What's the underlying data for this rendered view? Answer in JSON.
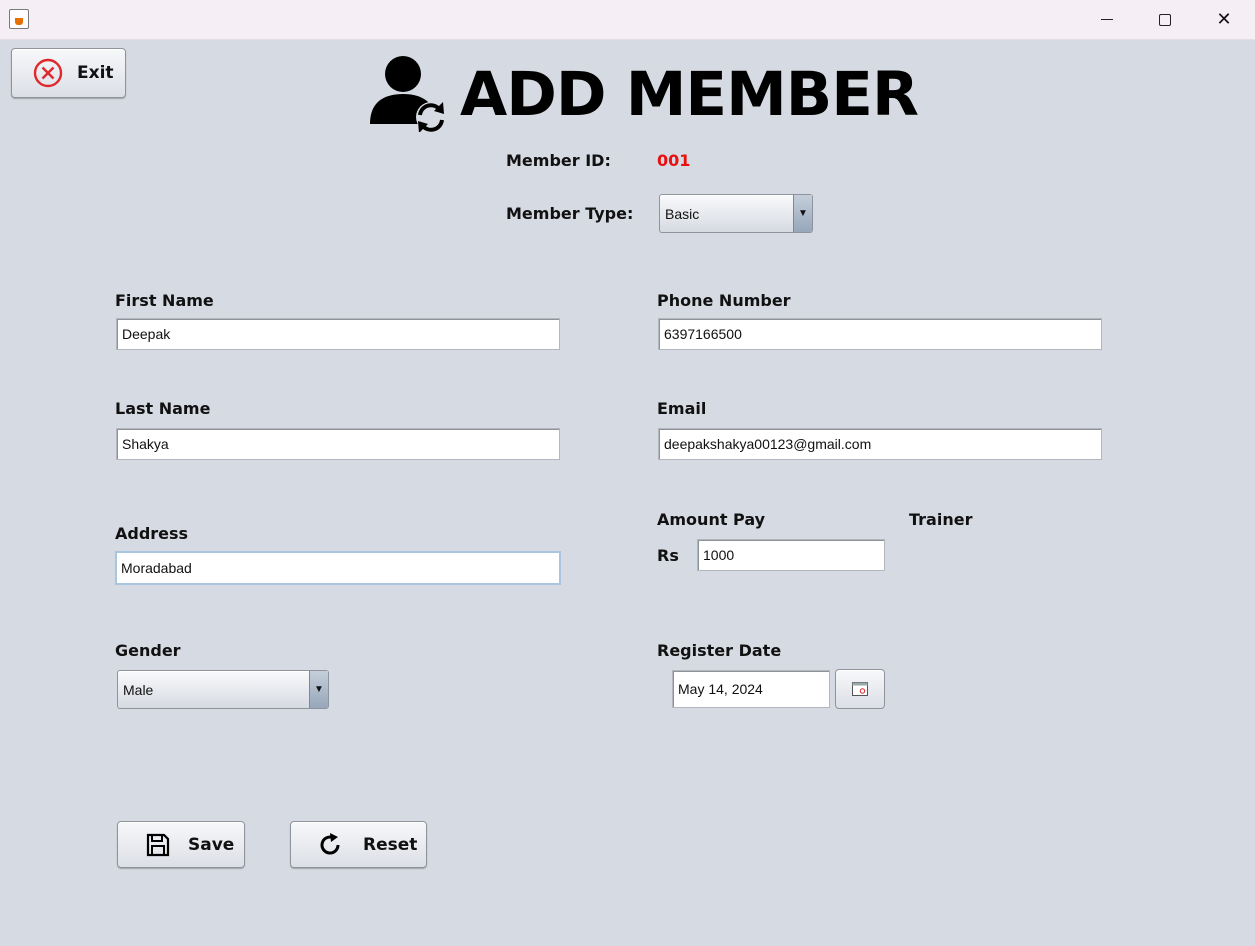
{
  "window": {
    "minimize_glyph": "minimize-icon",
    "maximize_glyph": "maximize-icon",
    "close_glyph": "✕"
  },
  "header": {
    "title": "ADD MEMBER",
    "exit_label": "Exit"
  },
  "form": {
    "member_id_label": "Member ID:",
    "member_id_value": "001",
    "member_type_label": "Member Type:",
    "member_type_value": "Basic",
    "first_name_label": "First Name",
    "first_name_value": "Deepak",
    "last_name_label": "Last Name",
    "last_name_value": "Shakya",
    "address_label": "Address",
    "address_value": "Moradabad",
    "gender_label": "Gender",
    "gender_value": "Male",
    "phone_label": "Phone Number",
    "phone_value": "6397166500",
    "email_label": "Email",
    "email_value": "deepakshakya00123@gmail.com",
    "amount_label": "Amount Pay",
    "currency_label": "Rs",
    "amount_value": "1000",
    "trainer_label": "Trainer",
    "register_date_label": "Register Date",
    "register_date_value": "May 14, 2024"
  },
  "actions": {
    "save_label": "Save",
    "reset_label": "Reset"
  },
  "colors": {
    "background": "#d6dae2",
    "member_id": "#e81010",
    "exit_icon": "#e0282c"
  }
}
